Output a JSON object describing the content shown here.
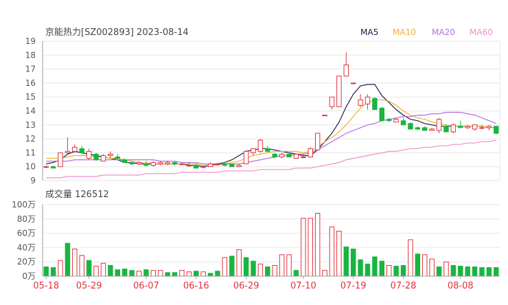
{
  "header": {
    "title": "京能热力[SZ002893] 2023-08-14",
    "legend": [
      {
        "label": "MA5",
        "color": "#1a1a4a"
      },
      {
        "label": "MA10",
        "color": "#f0b030"
      },
      {
        "label": "MA20",
        "color": "#b070e0"
      },
      {
        "label": "MA60",
        "color": "#f08cc8"
      }
    ]
  },
  "volume_label": "成交量 126512",
  "colors": {
    "up": "#e0313a",
    "down": "#19b541",
    "grid": "#e6e6e6",
    "axis": "#555555",
    "date": "#e0313a"
  },
  "chart_data": [
    {
      "type": "candlestick",
      "title": "京能热力[SZ002893] 2023-08-14",
      "ylim": [
        9,
        19
      ],
      "yticks": [
        "9",
        "10",
        "11",
        "12",
        "13",
        "14",
        "15",
        "16",
        "17",
        "18",
        "19"
      ],
      "grid": true,
      "series": [
        {
          "name": "price",
          "ohlc": [
            [
              10.0,
              10.1,
              9.9,
              10.0
            ],
            [
              10.0,
              10.1,
              9.9,
              9.9
            ],
            [
              10.0,
              11.0,
              10.0,
              11.0
            ],
            [
              11.0,
              12.1,
              10.9,
              11.1
            ],
            [
              11.1,
              11.6,
              11.0,
              11.4
            ],
            [
              11.3,
              11.5,
              10.9,
              11.0
            ],
            [
              10.6,
              11.3,
              10.5,
              11.1
            ],
            [
              10.9,
              11.0,
              10.4,
              10.5
            ],
            [
              10.4,
              10.9,
              10.4,
              10.8
            ],
            [
              10.8,
              11.1,
              10.6,
              10.9
            ],
            [
              10.7,
              10.9,
              10.5,
              10.6
            ],
            [
              10.5,
              10.6,
              10.3,
              10.3
            ],
            [
              10.3,
              10.4,
              10.1,
              10.2
            ],
            [
              10.2,
              10.4,
              10.1,
              10.3
            ],
            [
              10.2,
              10.4,
              10.0,
              10.1
            ],
            [
              10.1,
              10.4,
              10.0,
              10.3
            ],
            [
              10.2,
              10.4,
              10.1,
              10.3
            ],
            [
              10.2,
              10.4,
              10.1,
              10.3
            ],
            [
              10.3,
              10.4,
              10.1,
              10.2
            ],
            [
              10.2,
              10.3,
              10.1,
              10.2
            ],
            [
              10.1,
              10.3,
              10.0,
              10.1
            ],
            [
              10.1,
              10.2,
              9.9,
              9.9
            ],
            [
              10.0,
              10.1,
              9.9,
              10.0
            ],
            [
              10.0,
              10.3,
              10.0,
              10.2
            ],
            [
              10.2,
              10.3,
              10.1,
              10.2
            ],
            [
              10.2,
              10.3,
              10.0,
              10.1
            ],
            [
              10.2,
              10.2,
              10.0,
              10.0
            ],
            [
              10.0,
              10.2,
              10.0,
              10.1
            ],
            [
              10.2,
              11.2,
              10.2,
              11.1
            ],
            [
              11.0,
              11.3,
              10.8,
              11.3
            ],
            [
              11.1,
              12.0,
              11.0,
              11.9
            ],
            [
              11.3,
              11.5,
              11.0,
              11.1
            ],
            [
              10.9,
              11.0,
              10.6,
              10.7
            ],
            [
              10.7,
              11.0,
              10.6,
              10.9
            ],
            [
              10.9,
              11.0,
              10.7,
              10.7
            ],
            [
              10.6,
              10.9,
              10.6,
              10.9
            ],
            [
              10.7,
              10.9,
              10.6,
              10.7
            ],
            [
              10.7,
              11.4,
              10.7,
              11.3
            ],
            [
              11.2,
              12.4,
              11.2,
              12.4
            ],
            [
              13.7,
              13.7,
              13.7,
              13.7
            ],
            [
              14.3,
              15.0,
              14.1,
              15.0
            ],
            [
              14.3,
              16.5,
              14.3,
              16.5
            ],
            [
              16.5,
              18.2,
              16.5,
              17.3
            ],
            [
              16.0,
              16.0,
              15.9,
              16.0
            ],
            [
              14.4,
              15.2,
              14.3,
              14.8
            ],
            [
              14.5,
              15.2,
              14.1,
              15.0
            ],
            [
              14.9,
              15.0,
              14.1,
              14.1
            ],
            [
              14.2,
              14.3,
              13.3,
              13.3
            ],
            [
              13.4,
              13.5,
              13.2,
              13.3
            ],
            [
              13.2,
              13.5,
              13.2,
              13.4
            ],
            [
              13.3,
              13.5,
              13.0,
              13.0
            ],
            [
              13.1,
              13.2,
              12.7,
              12.7
            ],
            [
              12.8,
              12.9,
              12.6,
              12.7
            ],
            [
              12.8,
              12.9,
              12.6,
              12.6
            ],
            [
              12.6,
              12.8,
              12.6,
              12.7
            ],
            [
              12.6,
              13.5,
              12.4,
              13.4
            ],
            [
              12.9,
              13.0,
              12.5,
              12.5
            ],
            [
              12.5,
              13.1,
              12.4,
              13.0
            ],
            [
              12.9,
              13.3,
              12.8,
              12.8
            ],
            [
              12.8,
              13.0,
              12.7,
              12.9
            ],
            [
              12.7,
              13.0,
              12.6,
              13.0
            ],
            [
              12.8,
              13.0,
              12.7,
              12.8
            ],
            [
              12.8,
              13.0,
              12.6,
              12.9
            ],
            [
              12.9,
              12.9,
              12.3,
              12.4
            ]
          ]
        },
        {
          "name": "MA5",
          "values": [
            10.2,
            10.3,
            10.5,
            10.9,
            11.1,
            11.0,
            10.9,
            10.8,
            10.7,
            10.6,
            10.5,
            10.3,
            10.3,
            10.2,
            10.2,
            10.2,
            10.2,
            10.2,
            10.2,
            10.2,
            10.1,
            10.1,
            10.0,
            10.1,
            10.2,
            10.3,
            10.5,
            10.8,
            11.1,
            11.2,
            11.3,
            11.3,
            11.2,
            11.1,
            11.0,
            10.9,
            10.8,
            10.8,
            11.2,
            11.8,
            12.4,
            13.2,
            14.3,
            15.2,
            15.8,
            15.9,
            15.9,
            15.1,
            14.6,
            14.1,
            13.7,
            13.4,
            13.3,
            13.1,
            13.0,
            12.9,
            12.9,
            12.9,
            12.9,
            12.9,
            12.9,
            12.9,
            12.8,
            12.8
          ]
        },
        {
          "name": "MA10",
          "values": [
            10.6,
            10.6,
            10.6,
            10.7,
            10.8,
            10.8,
            10.8,
            10.7,
            10.7,
            10.6,
            10.6,
            10.5,
            10.4,
            10.3,
            10.3,
            10.2,
            10.2,
            10.2,
            10.2,
            10.2,
            10.2,
            10.2,
            10.1,
            10.1,
            10.1,
            10.2,
            10.3,
            10.4,
            10.6,
            10.8,
            10.9,
            11.0,
            11.1,
            11.1,
            11.1,
            11.1,
            11.0,
            11.1,
            11.4,
            11.8,
            12.1,
            12.5,
            13.0,
            13.6,
            14.2,
            14.6,
            14.8,
            14.8,
            14.7,
            14.4,
            14.0,
            13.7,
            13.5,
            13.4,
            13.2,
            13.1,
            13.0,
            12.9,
            12.9,
            12.9,
            12.9,
            12.9,
            12.8,
            12.8
          ]
        },
        {
          "name": "MA20",
          "values": [
            10.4,
            10.4,
            10.4,
            10.4,
            10.5,
            10.5,
            10.5,
            10.5,
            10.5,
            10.5,
            10.5,
            10.5,
            10.5,
            10.5,
            10.5,
            10.5,
            10.4,
            10.4,
            10.4,
            10.3,
            10.3,
            10.3,
            10.2,
            10.2,
            10.2,
            10.2,
            10.2,
            10.2,
            10.3,
            10.4,
            10.5,
            10.6,
            10.7,
            10.8,
            10.8,
            10.9,
            10.9,
            11.0,
            11.2,
            11.5,
            11.8,
            12.1,
            12.4,
            12.6,
            12.8,
            13.0,
            13.1,
            13.3,
            13.4,
            13.5,
            13.6,
            13.6,
            13.7,
            13.7,
            13.8,
            13.8,
            13.9,
            13.9,
            13.9,
            13.8,
            13.7,
            13.5,
            13.3,
            13.1
          ]
        },
        {
          "name": "MA60",
          "values": [
            9.2,
            9.2,
            9.2,
            9.3,
            9.3,
            9.3,
            9.3,
            9.3,
            9.4,
            9.4,
            9.4,
            9.4,
            9.4,
            9.4,
            9.5,
            9.5,
            9.5,
            9.5,
            9.5,
            9.6,
            9.6,
            9.6,
            9.6,
            9.6,
            9.6,
            9.7,
            9.7,
            9.7,
            9.7,
            9.7,
            9.8,
            9.8,
            9.8,
            9.8,
            9.8,
            9.9,
            9.9,
            9.9,
            10.0,
            10.1,
            10.2,
            10.3,
            10.5,
            10.6,
            10.7,
            10.8,
            10.9,
            11.0,
            11.1,
            11.1,
            11.2,
            11.3,
            11.3,
            11.4,
            11.4,
            11.5,
            11.5,
            11.6,
            11.6,
            11.7,
            11.7,
            11.8,
            11.8,
            11.9
          ]
        }
      ]
    },
    {
      "type": "bar",
      "title": "成交量 126512",
      "ylim": [
        0,
        100
      ],
      "yticks": [
        "0万",
        "20万",
        "40万",
        "60万",
        "80万",
        "100万"
      ],
      "grid": true,
      "categories": [
        "05-18",
        "",
        "",
        "",
        "",
        "05-29",
        "",
        "",
        "",
        "",
        "",
        "",
        "06-07",
        "",
        "",
        "",
        "",
        "",
        "",
        "06-16",
        "",
        "",
        "",
        "",
        "",
        "",
        "06-29",
        "",
        "",
        "",
        "",
        "",
        "",
        "07-10",
        "",
        "",
        "",
        "",
        "",
        "",
        "07-19",
        "",
        "",
        "",
        "",
        "",
        "",
        "07-28",
        "",
        "",
        "",
        "",
        "",
        "",
        "08-08",
        "",
        "",
        "",
        "",
        "",
        "",
        "",
        "",
        "",
        ""
      ],
      "x_labels": [
        "05-18",
        "05-29",
        "06-07",
        "06-16",
        "06-29",
        "07-10",
        "07-19",
        "07-28",
        "08-08"
      ],
      "x_label_index": [
        0,
        6,
        14,
        21,
        28,
        36,
        43,
        50,
        58
      ],
      "values": [
        13,
        12,
        22,
        46,
        38,
        29,
        22,
        14,
        18,
        15,
        9,
        10,
        8,
        7,
        9,
        8,
        8,
        5,
        5,
        8,
        6,
        7,
        6,
        4,
        7,
        26,
        28,
        37,
        26,
        21,
        17,
        13,
        15,
        30,
        30,
        8,
        81,
        81,
        88,
        8,
        69,
        63,
        41,
        38,
        23,
        17,
        27,
        21,
        15,
        14,
        15,
        51,
        31,
        30,
        24,
        13,
        20,
        15,
        14,
        13,
        13,
        12,
        12,
        12
      ],
      "direction": [
        "down",
        "down",
        "up",
        "down",
        "up",
        "up",
        "down",
        "up",
        "up",
        "down",
        "down",
        "down",
        "down",
        "up",
        "down",
        "up",
        "up",
        "down",
        "down",
        "up",
        "up",
        "down",
        "up",
        "down",
        "down",
        "up",
        "down",
        "up",
        "down",
        "down",
        "up",
        "down",
        "up",
        "up",
        "up",
        "down",
        "up",
        "up",
        "up",
        "up",
        "up",
        "up",
        "down",
        "down",
        "down",
        "down",
        "down",
        "down",
        "up",
        "down",
        "down",
        "up",
        "down",
        "up",
        "up",
        "down",
        "up",
        "down",
        "down",
        "down",
        "down",
        "down",
        "down",
        "down"
      ]
    }
  ]
}
